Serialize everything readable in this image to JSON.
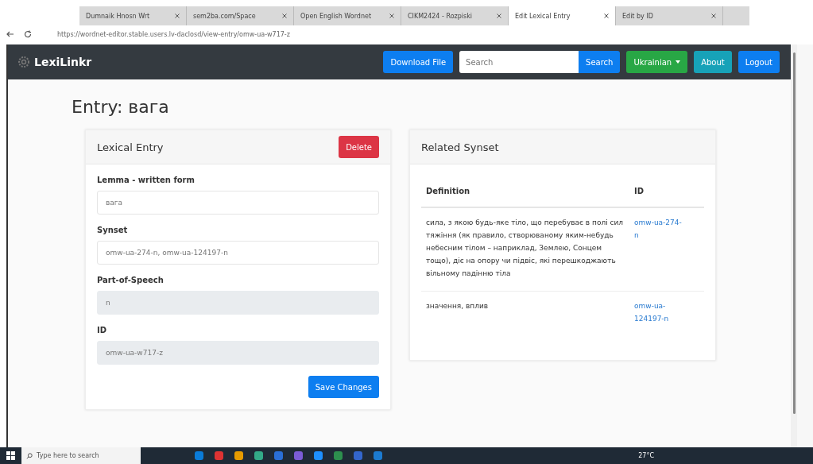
{
  "browser": {
    "tabs": [
      {
        "title": "Dumnaik Hnosn Wrt",
        "selected": false
      },
      {
        "title": "sem2ba.com/Space",
        "selected": false
      },
      {
        "title": "Open English Wordnet",
        "selected": false
      },
      {
        "title": "CIKM2424 - Rozpiski",
        "selected": false
      },
      {
        "title": "Edit Lexical Entry",
        "selected": true
      },
      {
        "title": "Edit by ID",
        "selected": false
      }
    ],
    "address": "https://wordnet-editor.stable.users.lv-daclosd/view-entry/omw-ua-w717-z"
  },
  "navbar": {
    "brand": "LexiLinkr",
    "download": "Download File",
    "search_placeholder": "Search",
    "search_button": "Search",
    "language": "Ukrainian",
    "links": [
      {
        "label": "About",
        "kind": "info"
      },
      {
        "label": "Logout",
        "kind": "primary"
      }
    ]
  },
  "page_title": "Entry: вага",
  "lexical_entry": {
    "title": "Lexical Entry",
    "delete": "Delete",
    "fields": [
      {
        "label": "Lemma - written form",
        "value": "вага",
        "disabled": false
      },
      {
        "label": "Synset",
        "value": "omw-ua-274-n, omw-ua-124197-n",
        "disabled": false
      },
      {
        "label": "Part-of-Speech",
        "value": "n",
        "disabled": true
      },
      {
        "label": "ID",
        "value": "omw-ua-w717-z",
        "disabled": true
      }
    ],
    "save": "Save Changes"
  },
  "related_synset": {
    "title": "Related Synset",
    "columns": [
      "Definition",
      "ID"
    ],
    "rows": [
      {
        "definition": "сила, з якою будь-яке тіло, що перебуває в полі сил тяжіння (як правило, створюваному яким-небудь небесним тілом – наприклад, Землею, Сонцем тощо), діє на опору чи підвіс, які перешкоджають вільному падінню тіла",
        "id": "omw-ua-274-n"
      },
      {
        "definition": "значення, вплив",
        "id": "omw-ua-124197-n"
      }
    ]
  },
  "taskbar": {
    "search_placeholder": "Type here to search",
    "weather": "27°C"
  }
}
